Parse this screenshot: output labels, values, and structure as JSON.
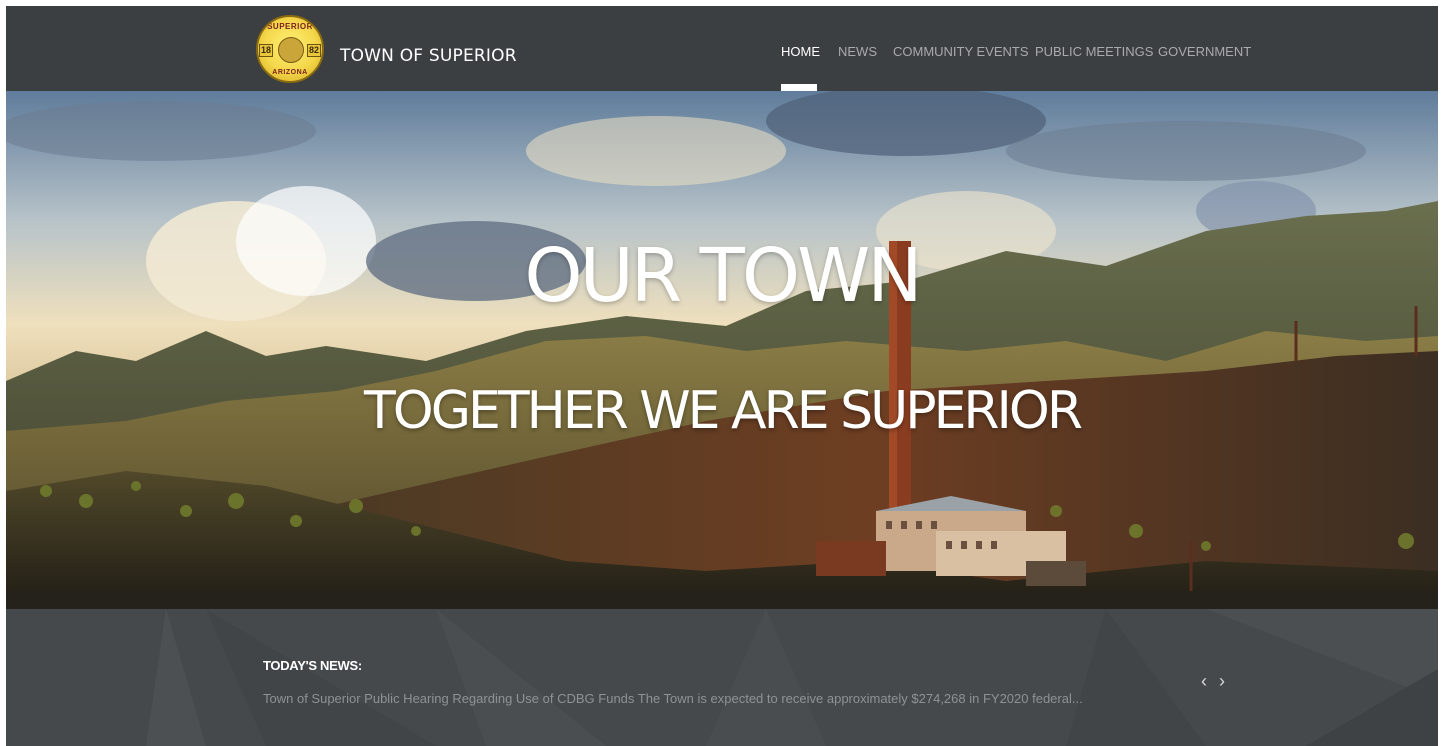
{
  "header": {
    "site_title": "TOWN OF SUPERIOR",
    "logo": {
      "top_text": "SUPERIOR",
      "bottom_text": "ARIZONA",
      "year_left": "18",
      "year_right": "82"
    },
    "nav": [
      {
        "label": "HOME",
        "active": true
      },
      {
        "label": "NEWS",
        "active": false
      },
      {
        "label": "COMMUNITY EVENTS",
        "active": false
      },
      {
        "label": "PUBLIC MEETINGS",
        "active": false
      },
      {
        "label": "GOVERNMENT",
        "active": false
      }
    ]
  },
  "hero": {
    "title": "OUR TOWN",
    "subtitle": "TOGETHER WE ARE SUPERIOR"
  },
  "news": {
    "label": "TODAY'S NEWS:",
    "headline": "Town of Superior Public Hearing Regarding Use of CDBG Funds  The Town is expected to receive approximately $274,268 in FY2020 federal...",
    "prev_symbol": "‹",
    "next_symbol": "›"
  },
  "colors": {
    "header_bg": "#3c3f41",
    "news_bg": "#46494b",
    "nav_inactive": "#a8aaab",
    "nav_active": "#ffffff"
  }
}
